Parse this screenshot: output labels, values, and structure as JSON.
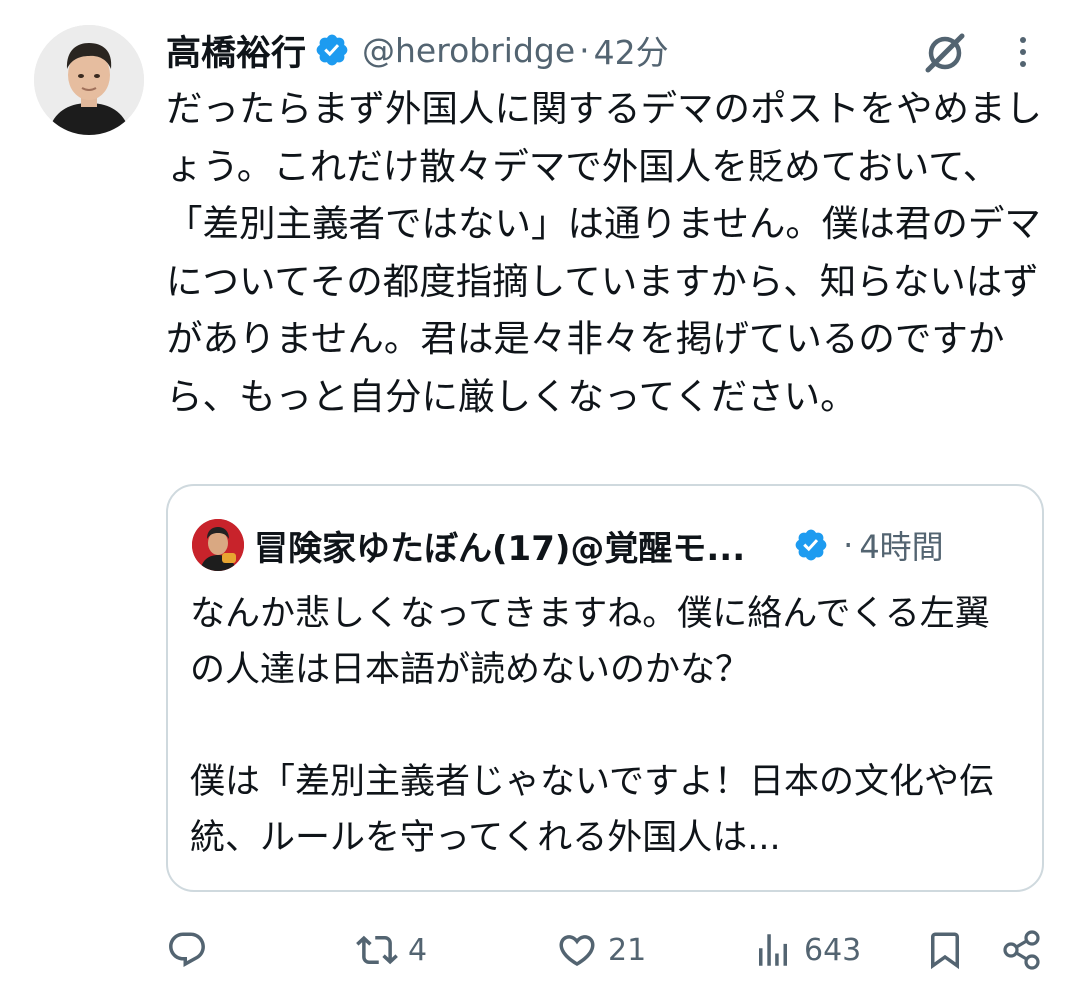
{
  "author": {
    "name": "高橋裕行",
    "handle": "@herobridge",
    "separator": "·",
    "time": "42分",
    "verified": true,
    "avatar_icon": "person-photo-icon"
  },
  "tweet": {
    "text": "だったらまず外国人に関するデマのポストをやめましょう。これだけ散々デマで外国人を貶めておいて、「差別主義者ではない」は通りません。僕は君のデマについてその都度指摘していますから、知らないはずがありません。君は是々非々を掲げているのですから、もっと自分に厳しくなってください。"
  },
  "quote": {
    "name": "冒険家ゆたぼん(17)@覚醒モ...",
    "separator": "·",
    "time": "4時間",
    "verified": true,
    "text": "なんか悲しくなってきますね。僕に絡んでくる左翼の人達は日本語が読めないのかな？\n\n僕は「差別主義者じゃないですよ！日本の文化や伝統、ルールを守ってくれる外国人は..."
  },
  "actions": {
    "reply": {
      "icon": "reply-icon"
    },
    "repost": {
      "icon": "repost-icon",
      "count": "4"
    },
    "like": {
      "icon": "heart-icon",
      "count": "21"
    },
    "views": {
      "icon": "views-icon",
      "count": "643"
    },
    "bookmark": {
      "icon": "bookmark-icon"
    },
    "share": {
      "icon": "share-icon"
    }
  },
  "colors": {
    "text": "#0f1419",
    "secondary": "#536471",
    "verified": "#1d9bf0",
    "border": "#cfd9de"
  }
}
